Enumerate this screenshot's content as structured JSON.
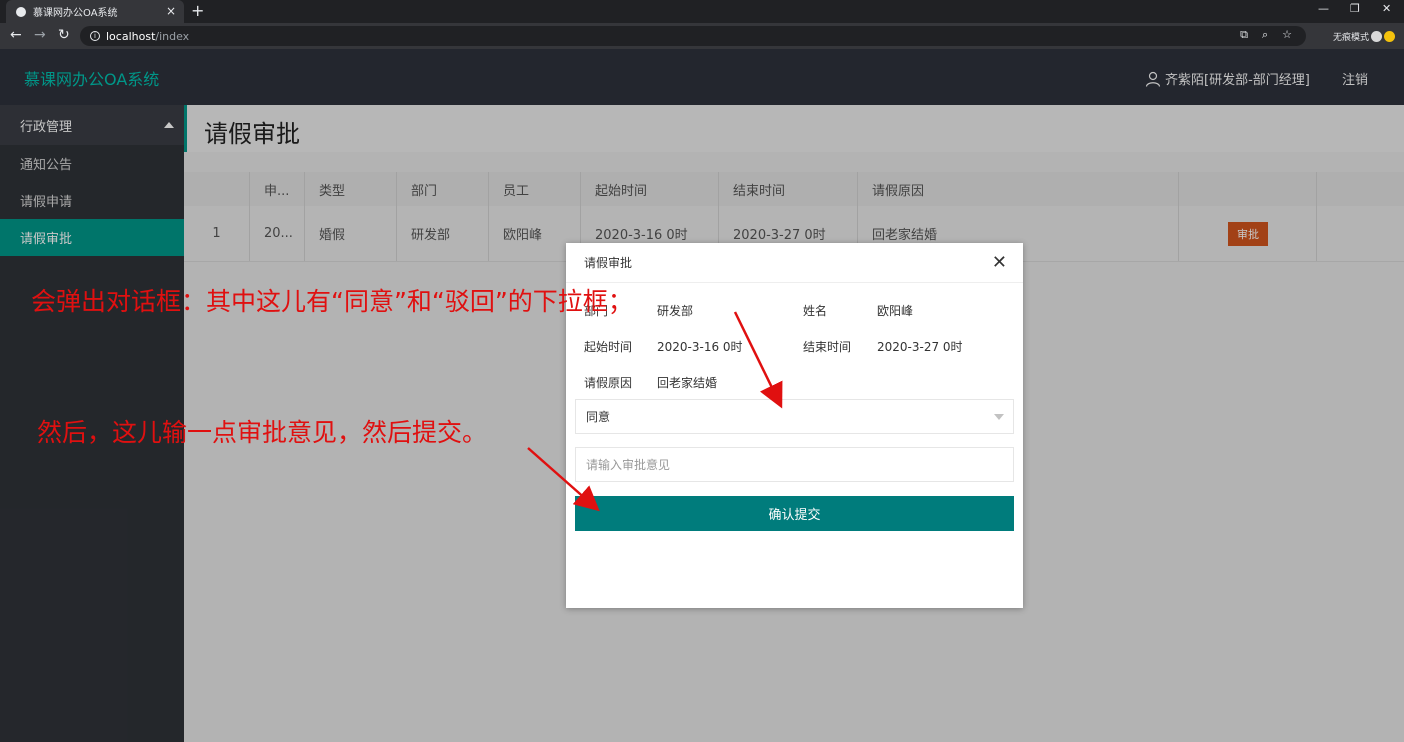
{
  "browser": {
    "tab_title": "慕课网办公OA系统",
    "tab_close": "×",
    "new_tab": "+",
    "url_host": "localhost",
    "url_path": "/index",
    "incognito_label": "无痕模式"
  },
  "header": {
    "logo": "慕课网办公OA系统",
    "user": "齐紫陌[研发部-部门经理]",
    "logout": "注销"
  },
  "sidebar": {
    "group": "行政管理",
    "items": [
      {
        "label": "通知公告"
      },
      {
        "label": "请假申请"
      },
      {
        "label": "请假审批"
      }
    ]
  },
  "page": {
    "title": "请假审批"
  },
  "table": {
    "headers": [
      "",
      "申...",
      "类型",
      "部门",
      "员工",
      "起始时间",
      "结束时间",
      "请假原因",
      "",
      ""
    ],
    "rows": [
      [
        "1",
        "20...",
        "婚假",
        "研发部",
        "欧阳峰",
        "2020-3-16 0时",
        "2020-3-27 0时",
        "回老家结婚",
        "审批",
        ""
      ]
    ]
  },
  "modal": {
    "title": "请假审批",
    "close": "✕",
    "dept_label": "部门",
    "dept_value": "研发部",
    "name_label": "姓名",
    "name_value": "欧阳峰",
    "start_label": "起始时间",
    "start_value": "2020-3-16 0时",
    "end_label": "结束时间",
    "end_value": "2020-3-27 0时",
    "reason_label": "请假原因",
    "reason_value": "回老家结婚",
    "select_value": "同意",
    "opinion_placeholder": "请输入审批意见",
    "submit_label": "确认提交"
  },
  "annotations": {
    "line1": "会弹出对话框：其中这儿有“同意”和“驳回”的下拉框；",
    "line2": "然后，这儿输一点审批意见，然后提交。"
  },
  "colors": {
    "accent": "#009688",
    "submit": "#007c7c",
    "approve_button": "#d0541d",
    "annotation": "#e01010"
  }
}
